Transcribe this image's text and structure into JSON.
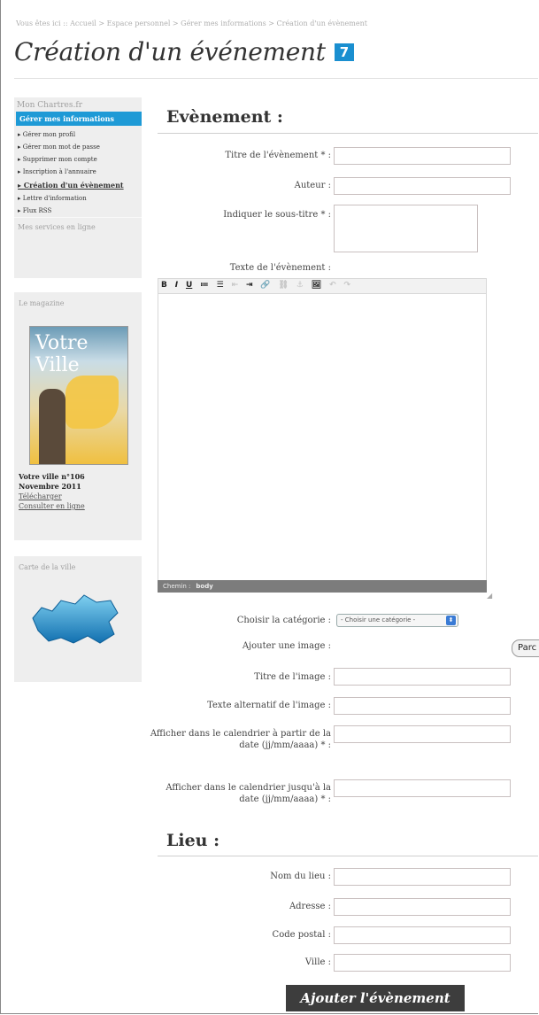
{
  "breadcrumb": "Vous êtes ici :: Accueil >  Espace personnel  >  Gérer mes informations  > Création d'un évènement",
  "page": {
    "title": "Création d'un événement",
    "badge": "7"
  },
  "sidebar": {
    "heading": "Mon Chartres.fr",
    "active": "Gérer mes informations",
    "items": [
      "▸ Gérer mon profil",
      "▸ Gérer mon mot de passe",
      "▸ Supprimer mon compte",
      "▸ Inscription à l'annuaire",
      "▸ Création d'un évènement",
      "▸ Lettre d'information",
      "▸ Flux RSS"
    ],
    "services": "Mes services en ligne"
  },
  "magazine": {
    "heading": "Le magazine",
    "cover_title": "Votre Ville",
    "issue": "Votre ville n°106",
    "date": "Novembre 2011",
    "download": "Télécharger",
    "online": "Consulter en ligne"
  },
  "city_map": {
    "heading": "Carte de la ville"
  },
  "event": {
    "heading": "Evènement :",
    "title_label": "Titre de l'évènement * :",
    "author_label": "Auteur :",
    "subtitle_label": "Indiquer le sous-titre * :",
    "text_label": "Texte de l'évènement :",
    "editor_path_label": "Chemin :",
    "editor_path_value": "body",
    "category_label": "Choisir la catégorie :",
    "category_value": "- Choisir une catégorie -",
    "image_label": "Ajouter une image :",
    "browse_label": "Parc",
    "image_title_label": "Titre de l'image :",
    "image_alt_label": "Texte alternatif de l'image :",
    "start_date_label": "Afficher dans le calendrier à partir de la date (jj/mm/aaaa) * :",
    "end_date_label": "Afficher dans le calendrier jusqu'à la date (jj/mm/aaaa) * :"
  },
  "toolbar": {
    "buttons": [
      "B",
      "I",
      "U",
      "≔",
      "☰",
      "⇤",
      "⇥",
      "🔗",
      "⛓",
      "⚓",
      "🖼",
      "↶",
      "↷"
    ]
  },
  "place": {
    "heading": "Lieu :",
    "name_label": "Nom du lieu :",
    "address_label": "Adresse :",
    "zip_label": "Code postal :",
    "city_label": "Ville :"
  },
  "submit_label": "Ajouter l'évènement"
}
